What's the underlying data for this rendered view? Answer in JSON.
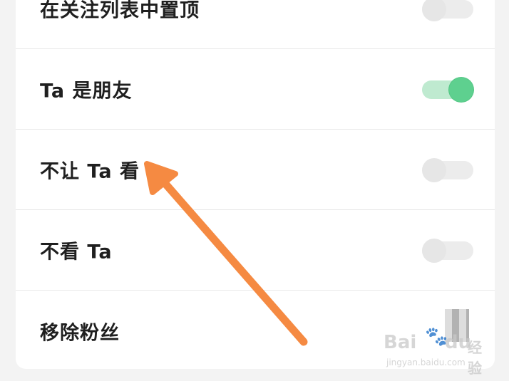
{
  "settings": {
    "rows": [
      {
        "label": "在关注列表中置顶",
        "toggle": "off"
      },
      {
        "label": "Ta 是朋友",
        "toggle": "on"
      },
      {
        "label": "不让 Ta 看",
        "toggle": "off"
      },
      {
        "label": "不看 Ta",
        "toggle": "off"
      },
      {
        "label": "移除粉丝"
      }
    ]
  },
  "colors": {
    "toggle_on": "#5ed08f",
    "toggle_off": "#e6e6e6",
    "annotation_arrow": "#f58a42"
  },
  "watermark": {
    "logo": "Bai",
    "logo_suffix": "du",
    "product": "经验",
    "url": "jingyan.baidu.com"
  }
}
